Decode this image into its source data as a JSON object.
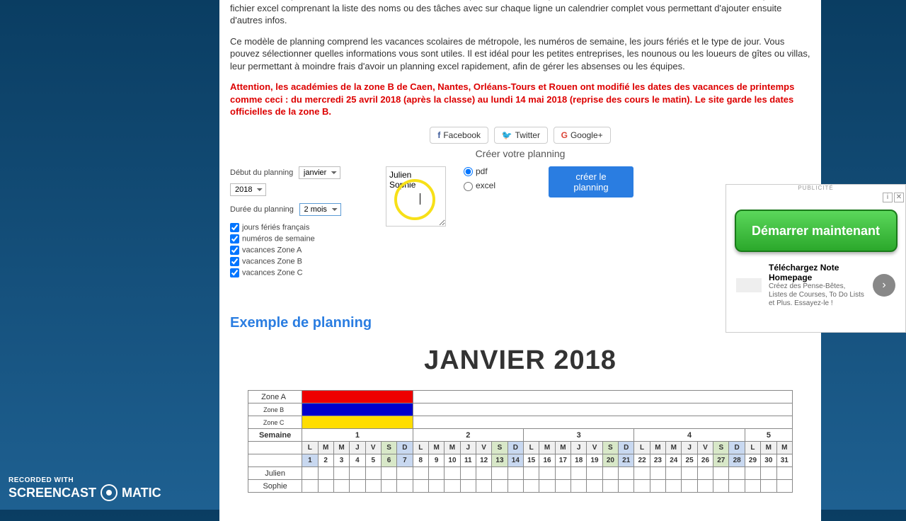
{
  "intro": {
    "p1": "vous cherchez sur internet un outil simple permettant de créer un planning excel. Devant le peu de site facile d'utilisation et gratuit, j'ai élaboré cet outil. Vous permettant de faire rapidement un planning gratuitement au format excel ou pdf. Choisissez le mois, l'année, sélectionnez la durée en mois puis entrez les noms de vos collaborateurs (42 noms maximum) ou des tâches à effectuer. Le site va alors créer un pdf ou un fichier excel comprenant la liste des noms ou des tâches avec sur chaque ligne un calendrier complet vous permettant d'ajouter ensuite d'autres infos.",
    "p2": "Ce modèle de planning comprend les vacances scolaires de métropole, les numéros de semaine, les jours fériés et le type de jour. Vous pouvez sélectionner quelles informations vous sont utiles. Il est idéal pour les petites entreprises, les nounous ou les loueurs de gîtes ou villas, leur permettant à moindre frais d'avoir un planning excel rapidement, afin de gérer les absenses ou les équipes.",
    "warn": "Attention, les académies de la zone B de Caen, Nantes, Orléans-Tours et Rouen ont modifié les dates des vacances de printemps comme ceci : du mercredi 25 avril 2018 (après la classe) au lundi 14 mai 2018 (reprise des cours le matin). Le site garde les dates officielles de la zone B."
  },
  "share": {
    "fb": "Facebook",
    "tw": "Twitter",
    "gp": "Google+"
  },
  "section_title": "Créer votre planning",
  "form": {
    "start_label": "Début du planning",
    "start_month": "janvier",
    "start_year": "2018",
    "duration_label": "Durée du planning",
    "duration_value": "2 mois",
    "checks": {
      "feries": "jours fériés français",
      "num": "numéros de semaine",
      "za": "vacances Zone A",
      "zb": "vacances Zone B",
      "zc": "vacances Zone C"
    },
    "names": "Julien\nSophie",
    "fmt_pdf": "pdf",
    "fmt_excel": "excel",
    "create": "créer le planning"
  },
  "ad": {
    "label": "PUBLICITÉ",
    "button": "Démarrer maintenant",
    "title": "Téléchargez Note Homepage",
    "desc": "Créez des Pense-Bêtes, Listes de Courses, To Do Lists et Plus. Essayez-le !"
  },
  "example_title": "Exemple de planning",
  "month_title": "JANVIER 2018",
  "zones": {
    "a": "Zone A",
    "b": "Zone B",
    "c": "Zone C"
  },
  "semaine": "Semaine",
  "weeks": [
    "1",
    "2",
    "3",
    "4",
    "5"
  ],
  "days_header": [
    "L",
    "M",
    "M",
    "J",
    "V",
    "S",
    "D",
    "L",
    "M",
    "M",
    "J",
    "V",
    "S",
    "D",
    "L",
    "M",
    "M",
    "J",
    "V",
    "S",
    "D",
    "L",
    "M",
    "M",
    "J",
    "V",
    "S",
    "D",
    "L",
    "M",
    "M"
  ],
  "dates": [
    "1",
    "2",
    "3",
    "4",
    "5",
    "6",
    "7",
    "8",
    "9",
    "10",
    "11",
    "12",
    "13",
    "14",
    "15",
    "16",
    "17",
    "18",
    "19",
    "20",
    "21",
    "22",
    "23",
    "24",
    "25",
    "26",
    "27",
    "28",
    "29",
    "30",
    "31"
  ],
  "people": [
    "Julien",
    "Sophie"
  ],
  "watermark": {
    "l1": "RECORDED WITH",
    "l2a": "SCREENCAST",
    "l2b": "MATIC"
  }
}
